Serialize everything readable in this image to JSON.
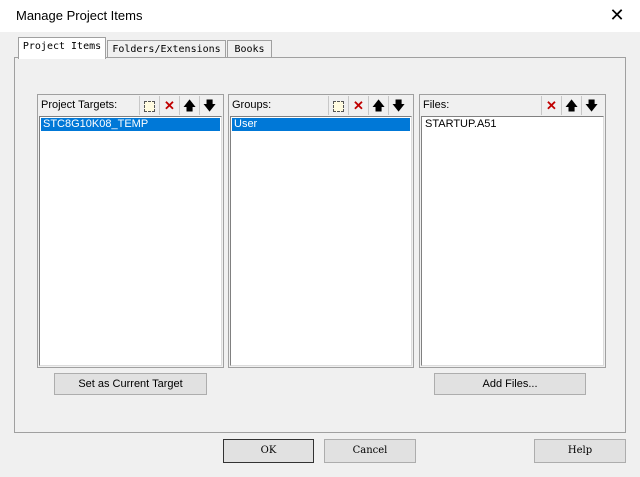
{
  "window": {
    "title": "Manage Project Items",
    "close_symbol": "✕"
  },
  "tabs": [
    {
      "label": "Project Items",
      "active": true
    },
    {
      "label": "Folders/Extensions",
      "active": false
    },
    {
      "label": "Books",
      "active": false
    }
  ],
  "targets": {
    "label": "Project Targets:",
    "items": [
      "STC8G10K08_TEMP"
    ],
    "selected": 0
  },
  "groups": {
    "label": "Groups:",
    "items": [
      "User"
    ],
    "selected": 0
  },
  "files": {
    "label": "Files:",
    "items": [
      "STARTUP.A51"
    ]
  },
  "icons": {
    "delete": "✕",
    "up": "🡅",
    "down": "🡇"
  },
  "buttons": {
    "set_target": "Set as Current Target",
    "add_files": "Add Files...",
    "ok": "OK",
    "cancel": "Cancel",
    "help": "Help"
  }
}
